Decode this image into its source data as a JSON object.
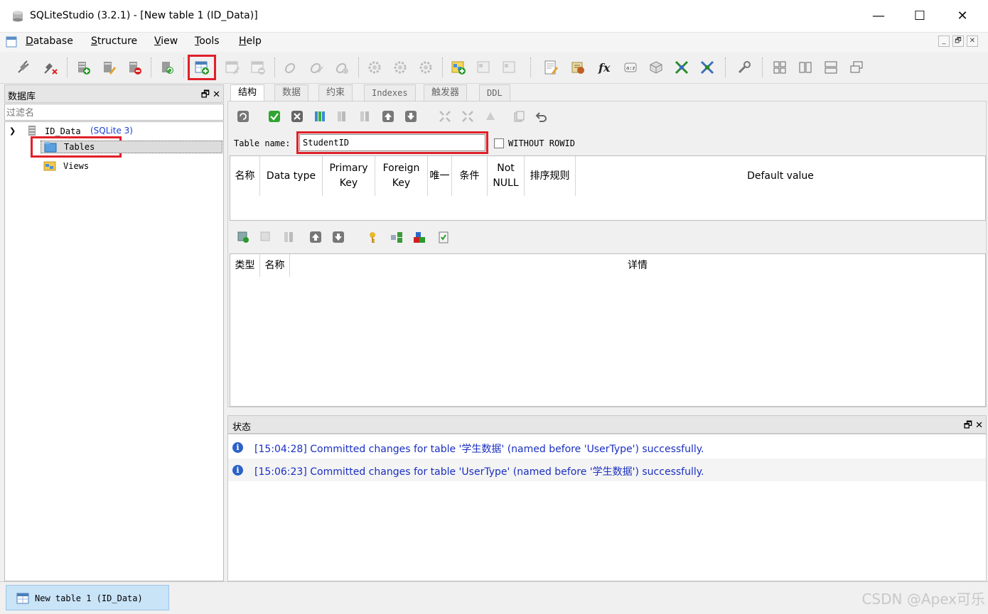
{
  "window": {
    "title": "SQLiteStudio (3.2.1) - [New table 1 (ID_Data)]",
    "controls": {
      "minimize": "—",
      "maximize": "☐",
      "close": "✕"
    }
  },
  "menu": {
    "items": [
      {
        "label": "Database",
        "mnemonic": "D"
      },
      {
        "label": "Structure",
        "mnemonic": "S"
      },
      {
        "label": "View",
        "mnemonic": "V"
      },
      {
        "label": "Tools",
        "mnemonic": "T"
      },
      {
        "label": "Help",
        "mnemonic": "H"
      }
    ],
    "mdi_controls": [
      "_",
      "🗗",
      "✕"
    ]
  },
  "db_panel": {
    "title": "数据库",
    "controls": "🗗 ✕",
    "filter_placeholder": "过滤名",
    "tree": {
      "database": "ID_Data",
      "db_type": "(SQLite 3)",
      "tables": "Tables",
      "views": "Views"
    }
  },
  "editor": {
    "tabs": [
      "结构",
      "数据",
      "约束",
      "Indexes",
      "触发器",
      "DDL"
    ],
    "active_tab": "结构",
    "table_name_label": "Table name:",
    "table_name_value": "StudentID",
    "without_rowid_label": "WITHOUT ROWID",
    "column_headers": [
      "名称",
      "Data type",
      "Primary Key",
      "Foreign Key",
      "唯一",
      "条件",
      "Not NULL",
      "排序规则",
      "Default value"
    ],
    "constraint_headers": [
      "类型",
      "名称",
      "详情"
    ]
  },
  "status_panel": {
    "title": "状态",
    "controls": "🗗 ✕",
    "messages": [
      "[15:04:28] Committed changes for table '学生数据' (named before 'UserType') successfully.",
      "[15:06:23] Committed changes for table 'UserType' (named before '学生数据') successfully."
    ]
  },
  "taskbar": {
    "item": "New table 1 (ID_Data)",
    "watermark": "CSDN @Apex可乐"
  },
  "colors": {
    "highlight": "#e0202a",
    "status_text": "#1a2fc0",
    "selection": "#c9e3f7"
  }
}
